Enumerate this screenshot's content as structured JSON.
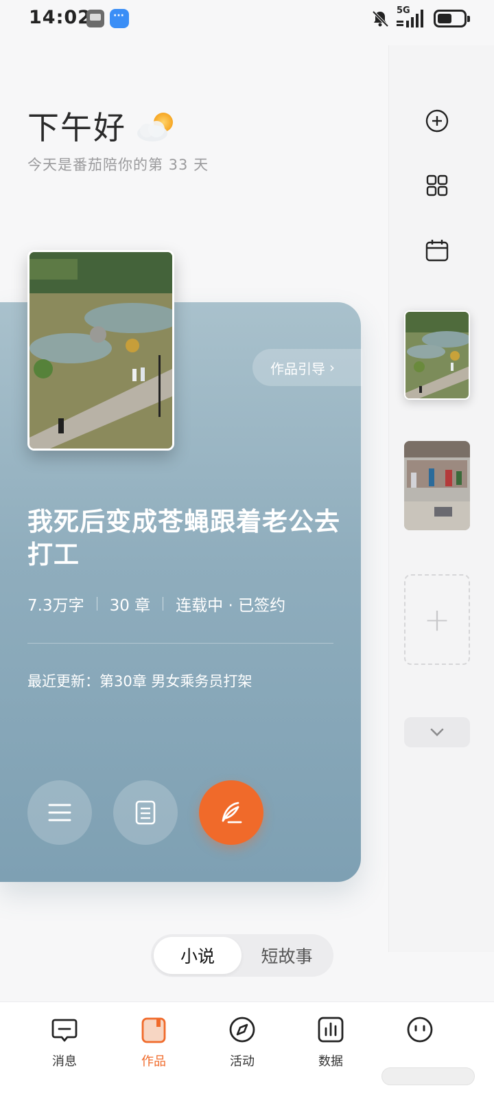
{
  "status_bar": {
    "time": "14:02",
    "network": "5G",
    "icons": [
      "video-app-icon",
      "message-app-icon",
      "mute-icon",
      "signal-icon",
      "battery-icon"
    ]
  },
  "greeting": {
    "title": "下午好",
    "weather_icon": "sun-behind-cloud-icon",
    "subtitle": "今天是番茄陪你的第 33 天"
  },
  "book": {
    "guide_label": "作品引导",
    "title": "我死后变成苍蝇跟着老公去打工",
    "word_count": "7.3万字",
    "chapters": "30 章",
    "status": "连载中 · 已签约",
    "latest_update": "最近更新：第30章 男女乘务员打架",
    "cover_icon": "park-photo-cover"
  },
  "actions": {
    "menu_icon": "menu-icon",
    "catalog_icon": "document-icon",
    "write_icon": "feather-pen-icon"
  },
  "rail": {
    "buttons": [
      "add-circle-icon",
      "grid-icon",
      "calendar-icon"
    ],
    "thumbnails": [
      "park-photo-thumb",
      "market-photo-thumb"
    ],
    "add_label": "+",
    "expand_icon": "chevron-down-icon"
  },
  "segment": {
    "tabs": [
      "小说",
      "短故事"
    ],
    "active": "小说"
  },
  "bottom_nav": {
    "items": [
      {
        "label": "消息",
        "icon": "message-icon"
      },
      {
        "label": "作品",
        "icon": "works-icon"
      },
      {
        "label": "活动",
        "icon": "compass-icon"
      },
      {
        "label": "数据",
        "icon": "chart-icon"
      },
      {
        "label": "",
        "icon": "face-icon"
      }
    ],
    "active": "作品"
  },
  "colors": {
    "accent": "#f06a2a",
    "card_top": "#a9c1cc",
    "card_bottom": "#7ea0b3",
    "background": "#f7f7f8"
  }
}
